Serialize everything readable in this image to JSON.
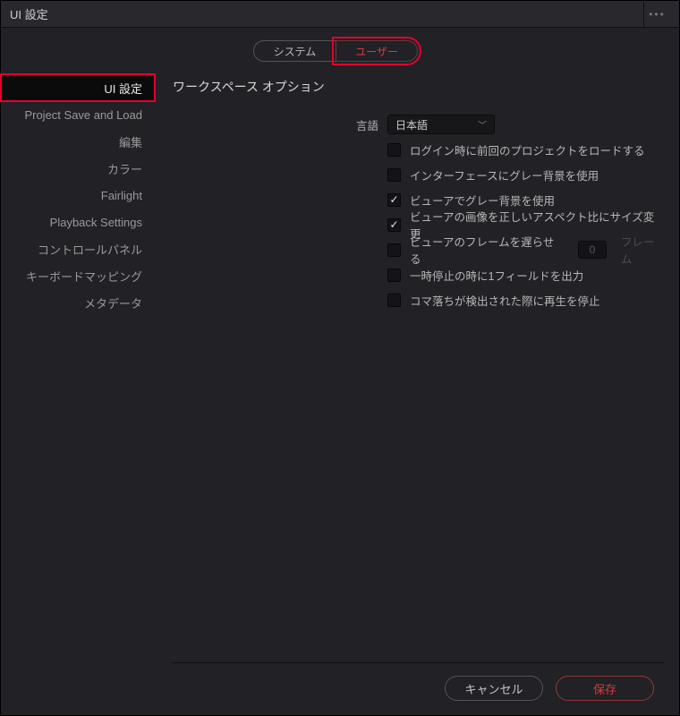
{
  "window": {
    "title": "UI 設定",
    "menu_icon": "•••"
  },
  "tabs": {
    "system": "システム",
    "user": "ユーザー",
    "active": "user"
  },
  "sidebar": {
    "items": [
      {
        "label": "UI 設定",
        "active": true
      },
      {
        "label": "Project Save and Load"
      },
      {
        "label": "編集"
      },
      {
        "label": "カラー"
      },
      {
        "label": "Fairlight"
      },
      {
        "label": "Playback Settings"
      },
      {
        "label": "コントロールパネル"
      },
      {
        "label": "キーボードマッピング"
      },
      {
        "label": "メタデータ"
      }
    ]
  },
  "content": {
    "section_title": "ワークスペース オプション",
    "language_label": "言語",
    "language_value": "日本語",
    "checks": [
      {
        "label": "ログイン時に前回のプロジェクトをロードする",
        "checked": false
      },
      {
        "label": "インターフェースにグレー背景を使用",
        "checked": false
      },
      {
        "label": "ビューアでグレー背景を使用",
        "checked": true
      },
      {
        "label": "ビューアの画像を正しいアスペクト比にサイズ変更",
        "checked": true
      },
      {
        "label": "ビューアのフレームを遅らせる",
        "checked": false,
        "has_number": true,
        "number": "0",
        "unit": "フレーム"
      },
      {
        "label": "一時停止の時に1フィールドを出力",
        "checked": false
      },
      {
        "label": "コマ落ちが検出された際に再生を停止",
        "checked": false
      }
    ]
  },
  "footer": {
    "cancel": "キャンセル",
    "save": "保存"
  }
}
